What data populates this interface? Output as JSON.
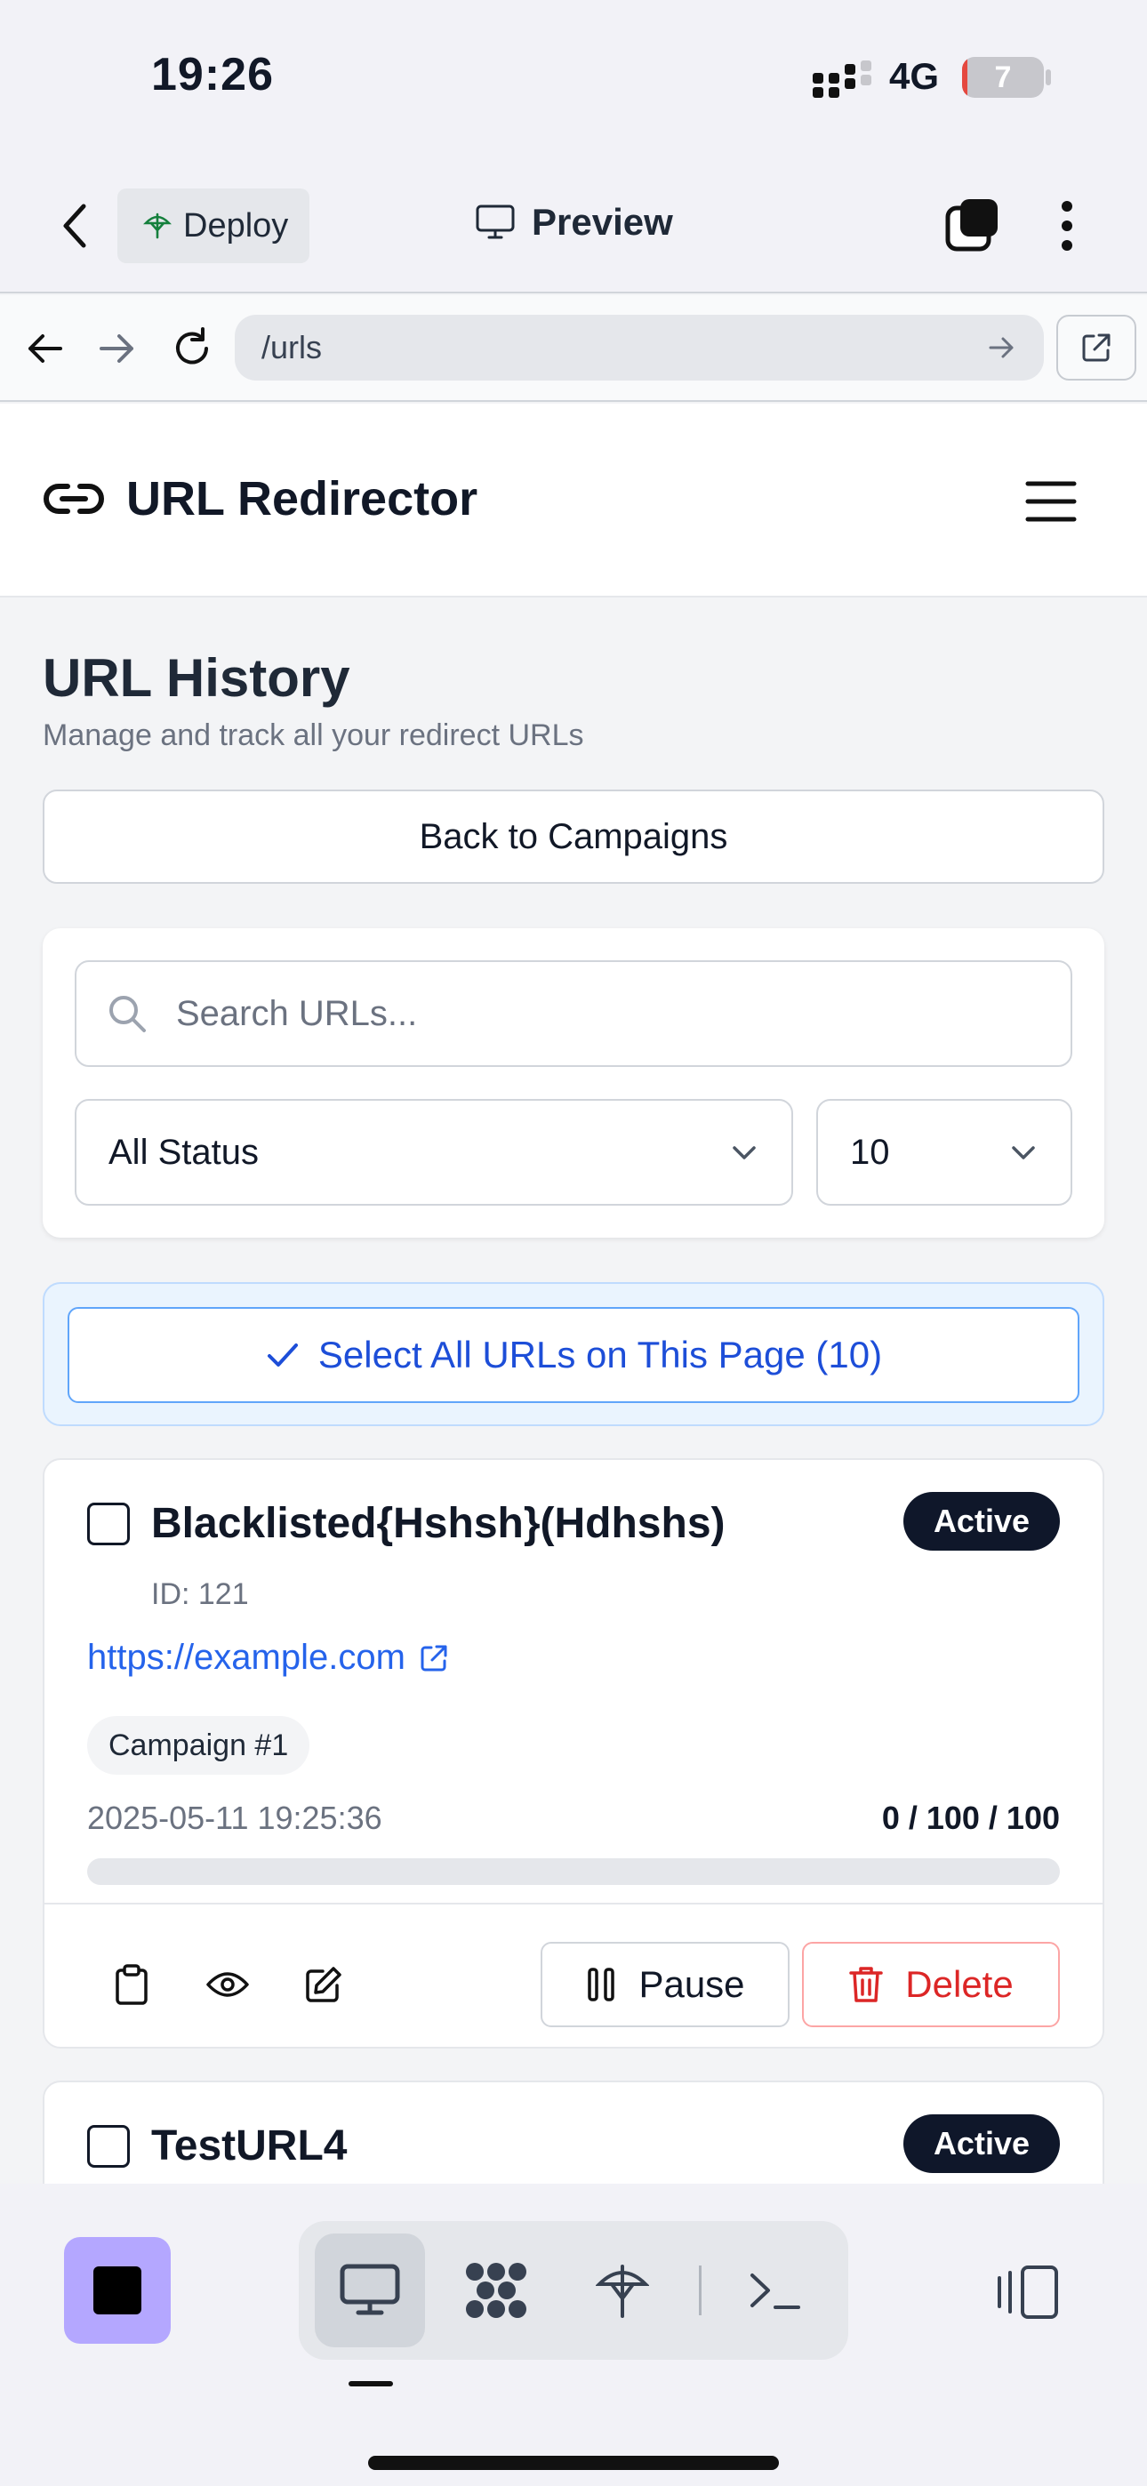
{
  "status_bar": {
    "time": "19:26",
    "network": "4G",
    "battery_level": "7",
    "battery_fraction": 0.07
  },
  "app_nav": {
    "deploy_label": "Deploy",
    "preview_label": "Preview"
  },
  "url_bar": {
    "path": "/urls"
  },
  "header": {
    "brand": "URL Redirector"
  },
  "page": {
    "title": "URL History",
    "subtitle": "Manage and track all your redirect URLs",
    "back_button": "Back to Campaigns"
  },
  "filters": {
    "search_placeholder": "Search URLs...",
    "status_value": "All Status",
    "page_size_value": "10"
  },
  "select_all_label": "Select All URLs on This Page (10)",
  "urls": [
    {
      "name": "Blacklisted{Hshsh}(Hdhshs)",
      "status": "Active",
      "id_label": "ID: 121",
      "link": "https://example.com",
      "campaign": "Campaign #1",
      "created": "2025-05-11 19:25:36",
      "counts": "0 / 100 / 100",
      "progress": 0,
      "pause_label": "Pause",
      "delete_label": "Delete"
    },
    {
      "name": "TestURL4",
      "status": "Active"
    }
  ],
  "colors": {
    "link": "#2563eb",
    "badge_bg": "#0f172a",
    "delete": "#dc2626",
    "select_all": "#1d4ed8",
    "stop_button": "#b4a7ff"
  }
}
